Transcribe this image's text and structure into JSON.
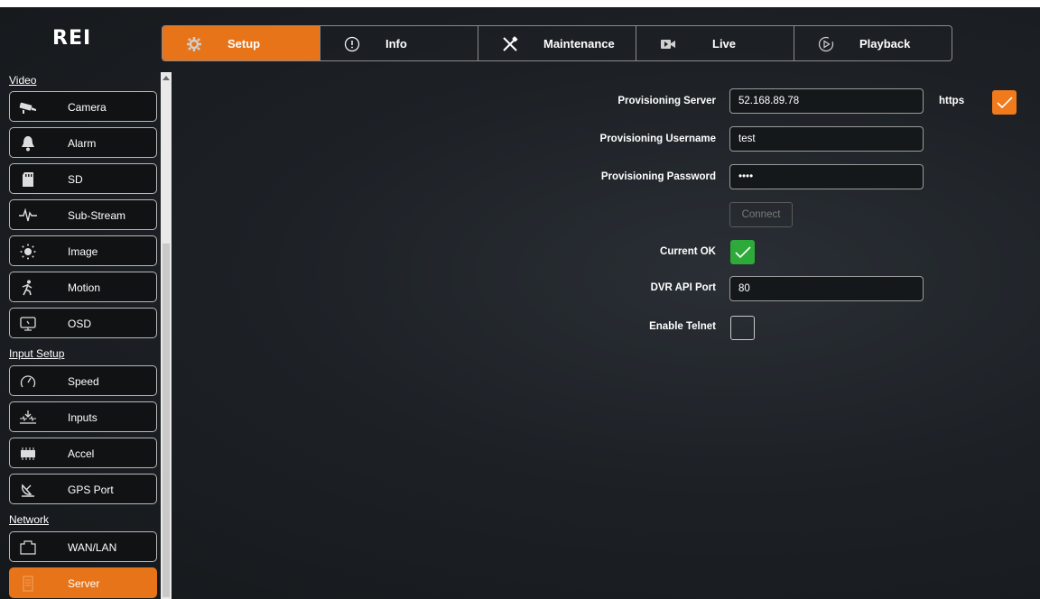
{
  "brand": {
    "logo": "REI"
  },
  "tabs": [
    {
      "label": "Setup",
      "icon": "gear-icon",
      "active": true
    },
    {
      "label": "Info",
      "icon": "info-icon",
      "active": false
    },
    {
      "label": "Maintenance",
      "icon": "tools-icon",
      "active": false
    },
    {
      "label": "Live",
      "icon": "video-icon",
      "active": false
    },
    {
      "label": "Playback",
      "icon": "playback-icon",
      "active": false
    }
  ],
  "sidebar": {
    "sections": [
      {
        "title": "Video",
        "items": [
          {
            "label": "Camera",
            "icon": "camera-icon"
          },
          {
            "label": "Alarm",
            "icon": "bell-icon"
          },
          {
            "label": "SD",
            "icon": "sd-card-icon"
          },
          {
            "label": "Sub-Stream",
            "icon": "waveform-icon"
          },
          {
            "label": "Image",
            "icon": "brightness-icon"
          },
          {
            "label": "Motion",
            "icon": "walking-icon"
          },
          {
            "label": "OSD",
            "icon": "monitor-icon"
          }
        ]
      },
      {
        "title": "Input Setup",
        "items": [
          {
            "label": "Speed",
            "icon": "speedometer-icon"
          },
          {
            "label": "Inputs",
            "icon": "inputs-icon"
          },
          {
            "label": "Accel",
            "icon": "chip-icon"
          },
          {
            "label": "GPS Port",
            "icon": "satellite-icon"
          }
        ]
      },
      {
        "title": "Network",
        "items": [
          {
            "label": "WAN/LAN",
            "icon": "network-port-icon"
          },
          {
            "label": "Server",
            "icon": "server-icon",
            "active": true
          }
        ]
      }
    ]
  },
  "form": {
    "provisioning_server_label": "Provisioning Server",
    "provisioning_server_value": "52.168.89.78",
    "https_label": "https",
    "https_checked": true,
    "provisioning_username_label": "Provisioning Username",
    "provisioning_username_value": "test",
    "provisioning_password_label": "Provisioning Password",
    "provisioning_password_value": "••••",
    "connect_label": "Connect",
    "current_ok_label": "Current OK",
    "current_ok_checked": true,
    "dvr_api_port_label": "DVR API Port",
    "dvr_api_port_value": "80",
    "enable_telnet_label": "Enable Telnet",
    "enable_telnet_checked": false
  },
  "colors": {
    "accent": "#e8741a",
    "success": "#2eaa3a",
    "background": "#1d2126"
  }
}
